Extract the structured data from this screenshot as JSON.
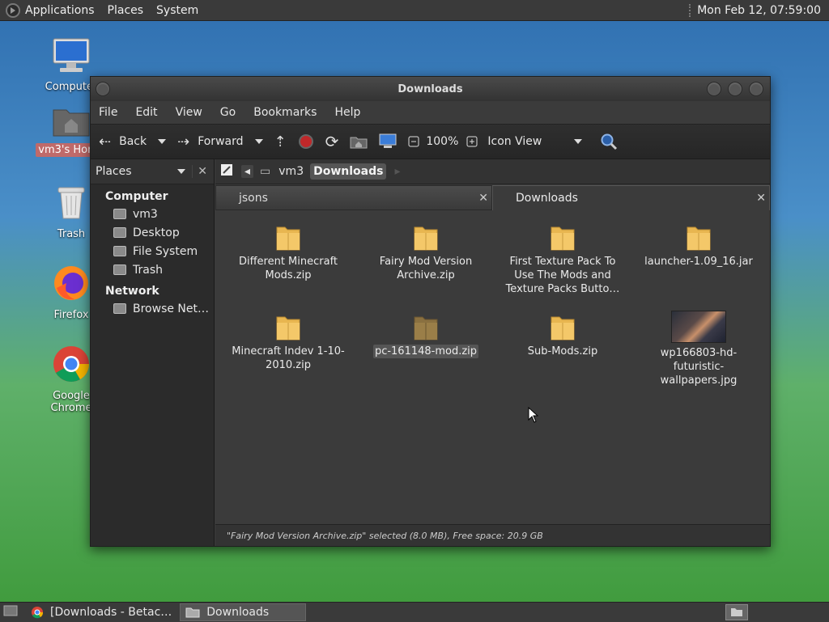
{
  "top_panel": {
    "menus": [
      "Applications",
      "Places",
      "System"
    ],
    "clock": "Mon Feb 12, 07:59:00"
  },
  "desktop": {
    "icons": [
      "Computer",
      "vm3's Home",
      "Trash",
      "Firefox",
      "Google Chrome"
    ]
  },
  "window": {
    "title": "Downloads",
    "menubar": [
      "File",
      "Edit",
      "View",
      "Go",
      "Bookmarks",
      "Help"
    ],
    "toolbar": {
      "back": "Back",
      "forward": "Forward",
      "zoom": "100%",
      "view_mode": "Icon View"
    },
    "sidebar": {
      "selector": "Places",
      "sections": [
        {
          "title": "Computer",
          "items": [
            "vm3",
            "Desktop",
            "File System",
            "Trash"
          ]
        },
        {
          "title": "Network",
          "items": [
            "Browse Net…"
          ]
        }
      ]
    },
    "pathbar": [
      "vm3",
      "Downloads"
    ],
    "tabs": [
      {
        "label": "jsons",
        "active": false
      },
      {
        "label": "Downloads",
        "active": true
      }
    ],
    "files": [
      {
        "name": "Different Minecraft Mods.zip",
        "kind": "archive"
      },
      {
        "name": "Fairy Mod Version Archive.zip",
        "kind": "archive"
      },
      {
        "name": "First Texture Pack To Use The Mods and Texture Packs Butto…",
        "kind": "archive"
      },
      {
        "name": "launcher-1.09_16.jar",
        "kind": "archive"
      },
      {
        "name": "Minecraft Indev 1-10-2010.zip",
        "kind": "archive"
      },
      {
        "name": "pc-161148-mod.zip",
        "kind": "archive-selected"
      },
      {
        "name": "Sub-Mods.zip",
        "kind": "archive"
      },
      {
        "name": "wp166803-hd-futuristic-wallpapers.jpg",
        "kind": "image"
      }
    ],
    "status": "\"Fairy Mod Version Archive.zip\" selected (8.0 MB), Free space: 20.9 GB"
  },
  "taskbar": {
    "items": [
      "[Downloads - Betac…",
      "Downloads"
    ]
  },
  "colors": {
    "folder": "#f0c060",
    "selection": "#555555"
  }
}
